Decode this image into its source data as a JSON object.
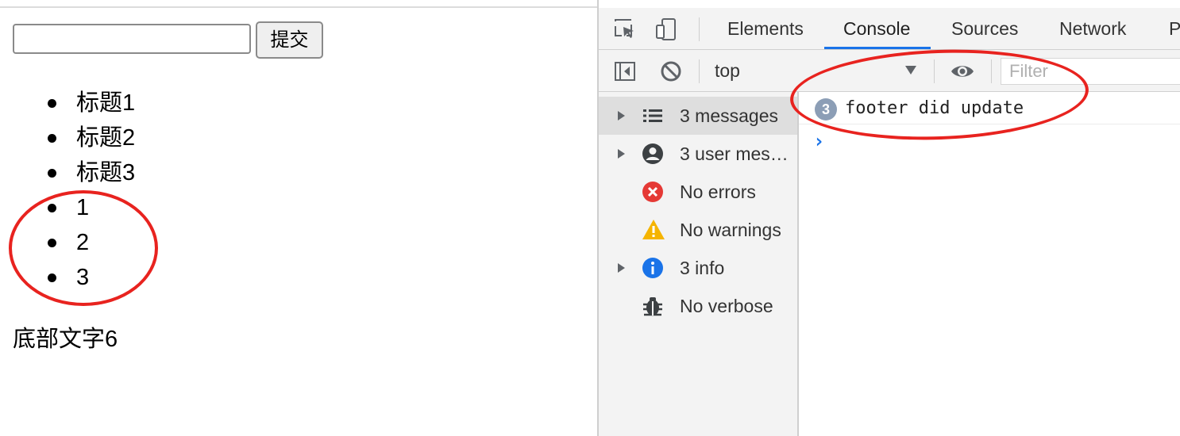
{
  "page": {
    "text_input_value": "",
    "submit_label": "提交",
    "list_items": [
      "标题1",
      "标题2",
      "标题3",
      "1",
      "2",
      "3"
    ],
    "footer_text": "底部文字6"
  },
  "devtools": {
    "tabs": [
      {
        "label": "Elements",
        "active": false
      },
      {
        "label": "Console",
        "active": true
      },
      {
        "label": "Sources",
        "active": false
      },
      {
        "label": "Network",
        "active": false
      },
      {
        "label": "P",
        "active": false
      }
    ],
    "toolbar": {
      "context": "top",
      "filter_placeholder": "Filter"
    },
    "sidebar": [
      {
        "label": "3 messages",
        "icon": "list-icon",
        "expandable": true,
        "selected": true
      },
      {
        "label": "3 user mes…",
        "icon": "user-icon",
        "expandable": true,
        "selected": false
      },
      {
        "label": "No errors",
        "icon": "error-icon",
        "expandable": false,
        "selected": false
      },
      {
        "label": "No warnings",
        "icon": "warning-icon",
        "expandable": false,
        "selected": false
      },
      {
        "label": "3 info",
        "icon": "info-icon",
        "expandable": true,
        "selected": false
      },
      {
        "label": "No verbose",
        "icon": "bug-icon",
        "expandable": false,
        "selected": false
      }
    ],
    "console": {
      "messages": [
        {
          "count": "3",
          "text": "footer did update"
        }
      ],
      "prompt": "›"
    }
  },
  "colors": {
    "accent": "#1a73e8",
    "annotation": "#e8231f",
    "error": "#e53935",
    "warning": "#f5b400",
    "info": "#1a73e8"
  }
}
